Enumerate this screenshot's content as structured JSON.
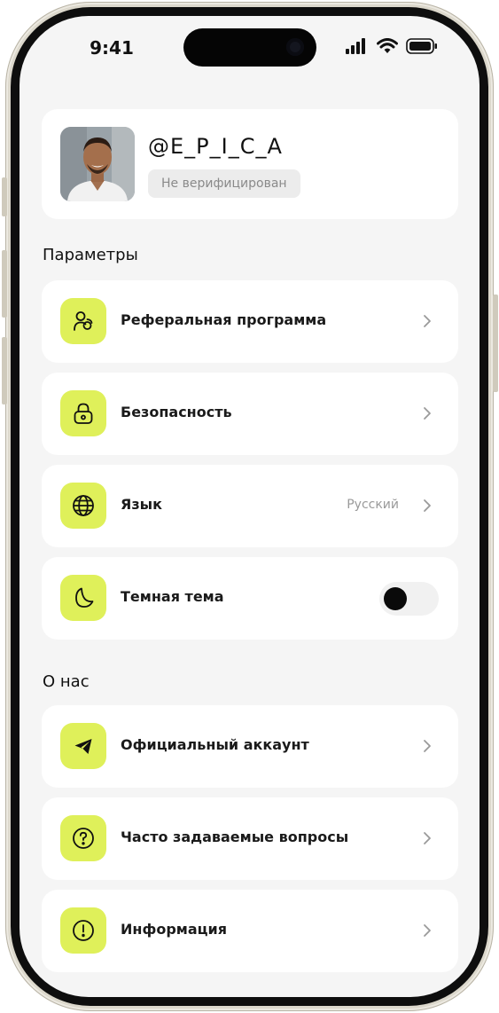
{
  "status": {
    "time": "9:41"
  },
  "profile": {
    "username": "@E_P_I_C_A",
    "verification": "Не верифицирован"
  },
  "sections": {
    "params_title": "Параметры",
    "about_title": "О нас"
  },
  "params": [
    {
      "label": "Реферальная программа",
      "icon": "users-icon"
    },
    {
      "label": "Безопасность",
      "icon": "lock-icon"
    },
    {
      "label": "Язык",
      "icon": "globe-icon",
      "value": "Русский"
    },
    {
      "label": "Темная тема",
      "icon": "moon-icon",
      "toggle": false
    }
  ],
  "about": [
    {
      "label": "Официальный аккаунт",
      "icon": "telegram-icon"
    },
    {
      "label": "Часто задаваемые вопросы",
      "icon": "question-icon"
    },
    {
      "label": "Информация",
      "icon": "info-icon"
    }
  ],
  "colors": {
    "accent": "#dff05a",
    "background": "#f5f5f5",
    "card": "#ffffff"
  }
}
